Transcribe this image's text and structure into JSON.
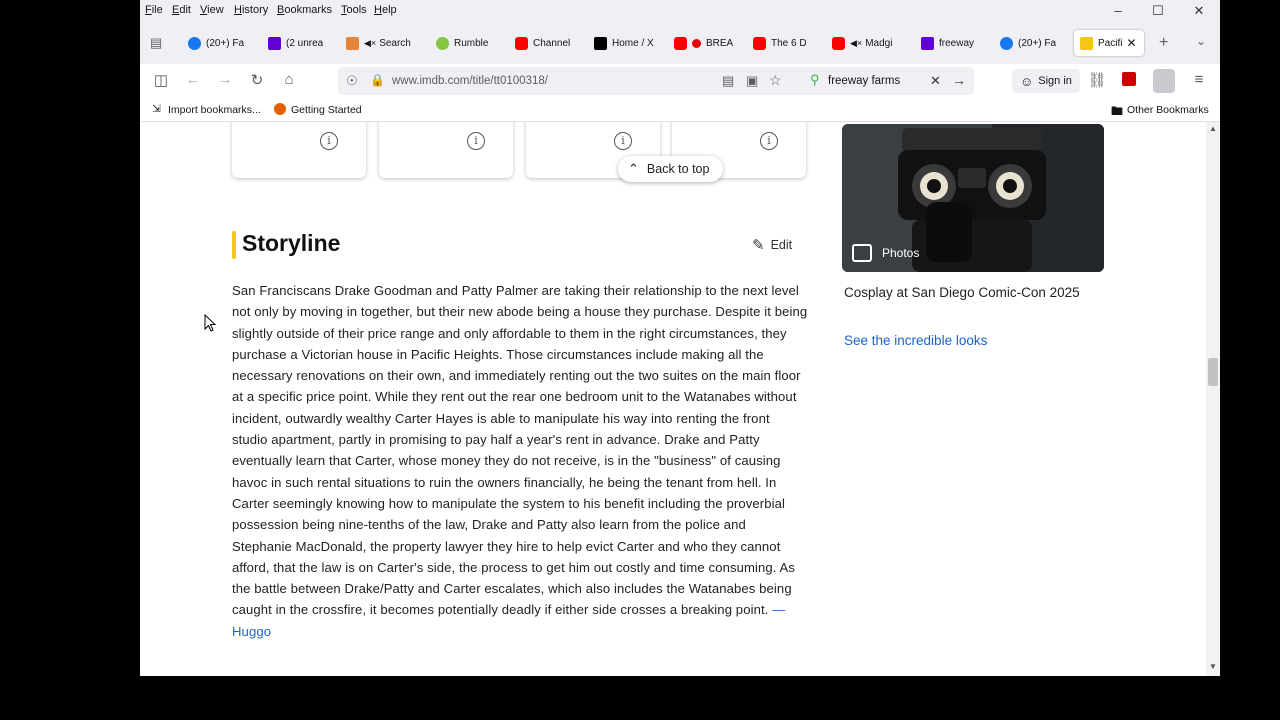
{
  "menu": [
    "File",
    "Edit",
    "View",
    "History",
    "Bookmarks",
    "Tools",
    "Help"
  ],
  "tabs": [
    {
      "label": "(20+) Fa",
      "icon": "facebook-icon",
      "color": "#1877f2"
    },
    {
      "label": "(2 unrea",
      "icon": "mail-icon",
      "color": "#6001d2"
    },
    {
      "label": "Search",
      "icon": "envelope-icon",
      "color": "#e8833a"
    },
    {
      "label": "Rumble",
      "icon": "rumble-icon",
      "color": "#85c742"
    },
    {
      "label": "Channel",
      "icon": "youtube-icon",
      "color": "#ff0000"
    },
    {
      "label": "Home / X",
      "icon": "x-icon",
      "color": "#000000"
    },
    {
      "label": "BREA",
      "icon": "youtube-icon",
      "color": "#ff0000"
    },
    {
      "label": "The 6 D",
      "icon": "youtube-icon",
      "color": "#ff0000"
    },
    {
      "label": "Madgi",
      "icon": "youtube-icon",
      "color": "#ff0000"
    },
    {
      "label": "freeway",
      "icon": "yahoo-icon",
      "color": "#6001d2"
    },
    {
      "label": "(20+) Fa",
      "icon": "facebook-icon",
      "color": "#1877f2"
    },
    {
      "label": "Pacifi",
      "icon": "imdb-icon",
      "color": "#f5c518"
    }
  ],
  "nav": {
    "url": "www.imdb.com/title/tt0100318/",
    "search_value": "freeway farms",
    "sign_in": "Sign in"
  },
  "bookmarks": {
    "import": "Import bookmarks...",
    "getting_started": "Getting Started",
    "other": "Other Bookmarks"
  },
  "page": {
    "back_to_top": "Back to top",
    "storyline_title": "Storyline",
    "edit": "Edit",
    "plot": "San Franciscans Drake Goodman and Patty Palmer are taking their relationship to the next level not only by moving in together, but their new abode being a house they purchase. Despite it being slightly outside of their price range and only affordable to them in the right circumstances, they purchase a Victorian house in Pacific Heights. Those circumstances include making all the necessary renovations on their own, and immediately renting out the two suites on the main floor at a specific price point. While they rent out the rear one bedroom unit to the Watanabes without incident, outwardly wealthy Carter Hayes is able to manipulate his way into renting the front studio apartment, partly in promising to pay half a year's rent in advance. Drake and Patty eventually learn that Carter, whose money they do not receive, is in the \"business\" of causing havoc in such rental situations to ruin the owners financially, he being the tenant from hell. In Carter seemingly knowing how to manipulate the system to his benefit including the proverbial possession being nine-tenths of the law, Drake and Patty also learn from the police and Stephanie MacDonald, the property lawyer they hire to help evict Carter and who they cannot afford, that the law is on Carter's side, the process to get him out costly and time consuming. As the battle between Drake/Patty and Carter escalates, which also includes the Watanabes being caught in the crossfire, it becomes potentially deadly if either side crosses a breaking point.",
    "plot_author": "—Huggo",
    "photos_label": "Photos",
    "photo_caption": "Cosplay at San Diego Comic-Con 2025",
    "photo_link": "See the incredible looks"
  }
}
